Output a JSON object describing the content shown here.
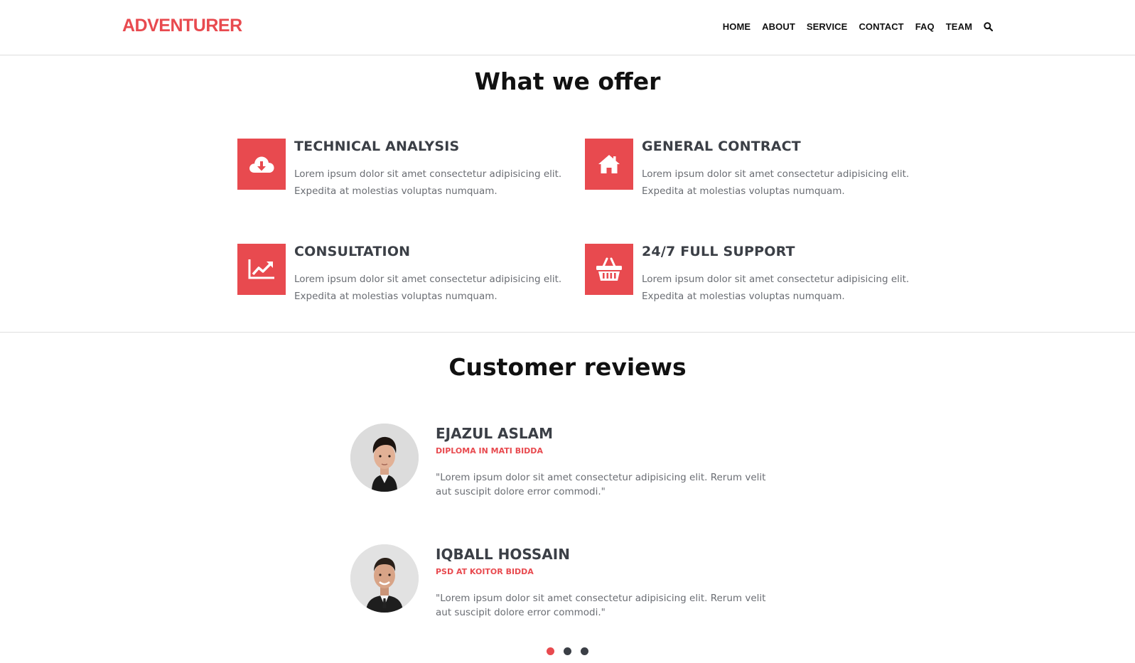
{
  "brand": {
    "logo": "ADVENTURER",
    "accent_color": "#e84a4f"
  },
  "nav": {
    "items": [
      {
        "label": "HOME"
      },
      {
        "label": "ABOUT"
      },
      {
        "label": "SERVICE"
      },
      {
        "label": "CONTACT"
      },
      {
        "label": "FAQ"
      },
      {
        "label": "TEAM"
      }
    ],
    "search_icon": "search-icon"
  },
  "offer": {
    "title": "What we offer",
    "items": [
      {
        "heading": "TECHNICAL ANALYSIS",
        "text": "Lorem ipsum dolor sit amet consectetur adipisicing elit. Expedita at molestias voluptas numquam.",
        "icon": "cloud-download-icon"
      },
      {
        "heading": "GENERAL CONTRACT",
        "text": "Lorem ipsum dolor sit amet consectetur adipisicing elit. Expedita at molestias voluptas numquam.",
        "icon": "home-icon"
      },
      {
        "heading": "CONSULTATION",
        "text": "Lorem ipsum dolor sit amet consectetur adipisicing elit. Expedita at molestias voluptas numquam.",
        "icon": "line-chart-icon"
      },
      {
        "heading": "24/7 FULL SUPPORT",
        "text": "Lorem ipsum dolor sit amet consectetur adipisicing elit. Expedita at molestias voluptas numquam.",
        "icon": "basket-icon"
      }
    ]
  },
  "reviews": {
    "title": "Customer reviews",
    "items": [
      {
        "name": "EJAZUL ASLAM",
        "role": "DIPLOMA IN MATI BIDDA",
        "quote": "\"Lorem ipsum dolor sit amet consectetur adipisicing elit. Rerum velit aut suscipit dolore error commodi.\""
      },
      {
        "name": "IQBALL HOSSAIN",
        "role": "PSD AT KOITOR BIDDA",
        "quote": "\"Lorem ipsum dolor sit amet consectetur adipisicing elit. Rerum velit aut suscipit dolore error commodi.\""
      }
    ],
    "carousel": {
      "pages": 3,
      "active": 1
    }
  }
}
